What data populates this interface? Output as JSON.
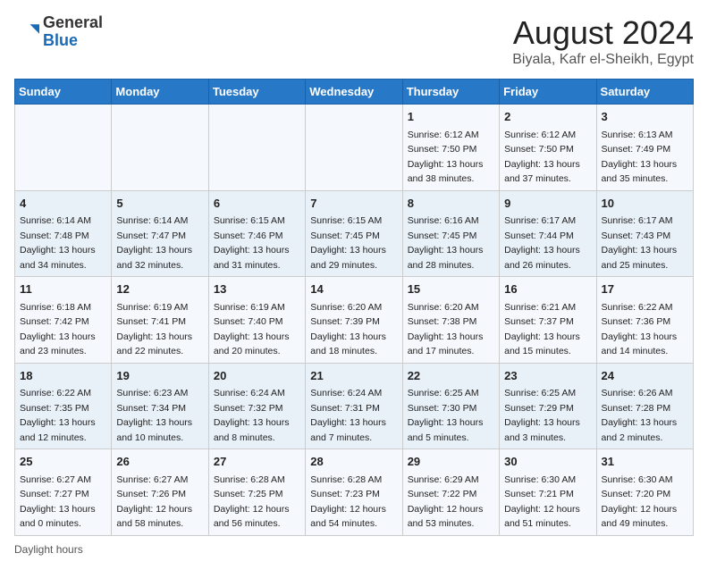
{
  "logo": {
    "general": "General",
    "blue": "Blue"
  },
  "title": "August 2024",
  "subtitle": "Biyala, Kafr el-Sheikh, Egypt",
  "days_of_week": [
    "Sunday",
    "Monday",
    "Tuesday",
    "Wednesday",
    "Thursday",
    "Friday",
    "Saturday"
  ],
  "weeks": [
    [
      {
        "day": "",
        "info": ""
      },
      {
        "day": "",
        "info": ""
      },
      {
        "day": "",
        "info": ""
      },
      {
        "day": "",
        "info": ""
      },
      {
        "day": "1",
        "info": "Sunrise: 6:12 AM\nSunset: 7:50 PM\nDaylight: 13 hours and 38 minutes."
      },
      {
        "day": "2",
        "info": "Sunrise: 6:12 AM\nSunset: 7:50 PM\nDaylight: 13 hours and 37 minutes."
      },
      {
        "day": "3",
        "info": "Sunrise: 6:13 AM\nSunset: 7:49 PM\nDaylight: 13 hours and 35 minutes."
      }
    ],
    [
      {
        "day": "4",
        "info": "Sunrise: 6:14 AM\nSunset: 7:48 PM\nDaylight: 13 hours and 34 minutes."
      },
      {
        "day": "5",
        "info": "Sunrise: 6:14 AM\nSunset: 7:47 PM\nDaylight: 13 hours and 32 minutes."
      },
      {
        "day": "6",
        "info": "Sunrise: 6:15 AM\nSunset: 7:46 PM\nDaylight: 13 hours and 31 minutes."
      },
      {
        "day": "7",
        "info": "Sunrise: 6:15 AM\nSunset: 7:45 PM\nDaylight: 13 hours and 29 minutes."
      },
      {
        "day": "8",
        "info": "Sunrise: 6:16 AM\nSunset: 7:45 PM\nDaylight: 13 hours and 28 minutes."
      },
      {
        "day": "9",
        "info": "Sunrise: 6:17 AM\nSunset: 7:44 PM\nDaylight: 13 hours and 26 minutes."
      },
      {
        "day": "10",
        "info": "Sunrise: 6:17 AM\nSunset: 7:43 PM\nDaylight: 13 hours and 25 minutes."
      }
    ],
    [
      {
        "day": "11",
        "info": "Sunrise: 6:18 AM\nSunset: 7:42 PM\nDaylight: 13 hours and 23 minutes."
      },
      {
        "day": "12",
        "info": "Sunrise: 6:19 AM\nSunset: 7:41 PM\nDaylight: 13 hours and 22 minutes."
      },
      {
        "day": "13",
        "info": "Sunrise: 6:19 AM\nSunset: 7:40 PM\nDaylight: 13 hours and 20 minutes."
      },
      {
        "day": "14",
        "info": "Sunrise: 6:20 AM\nSunset: 7:39 PM\nDaylight: 13 hours and 18 minutes."
      },
      {
        "day": "15",
        "info": "Sunrise: 6:20 AM\nSunset: 7:38 PM\nDaylight: 13 hours and 17 minutes."
      },
      {
        "day": "16",
        "info": "Sunrise: 6:21 AM\nSunset: 7:37 PM\nDaylight: 13 hours and 15 minutes."
      },
      {
        "day": "17",
        "info": "Sunrise: 6:22 AM\nSunset: 7:36 PM\nDaylight: 13 hours and 14 minutes."
      }
    ],
    [
      {
        "day": "18",
        "info": "Sunrise: 6:22 AM\nSunset: 7:35 PM\nDaylight: 13 hours and 12 minutes."
      },
      {
        "day": "19",
        "info": "Sunrise: 6:23 AM\nSunset: 7:34 PM\nDaylight: 13 hours and 10 minutes."
      },
      {
        "day": "20",
        "info": "Sunrise: 6:24 AM\nSunset: 7:32 PM\nDaylight: 13 hours and 8 minutes."
      },
      {
        "day": "21",
        "info": "Sunrise: 6:24 AM\nSunset: 7:31 PM\nDaylight: 13 hours and 7 minutes."
      },
      {
        "day": "22",
        "info": "Sunrise: 6:25 AM\nSunset: 7:30 PM\nDaylight: 13 hours and 5 minutes."
      },
      {
        "day": "23",
        "info": "Sunrise: 6:25 AM\nSunset: 7:29 PM\nDaylight: 13 hours and 3 minutes."
      },
      {
        "day": "24",
        "info": "Sunrise: 6:26 AM\nSunset: 7:28 PM\nDaylight: 13 hours and 2 minutes."
      }
    ],
    [
      {
        "day": "25",
        "info": "Sunrise: 6:27 AM\nSunset: 7:27 PM\nDaylight: 13 hours and 0 minutes."
      },
      {
        "day": "26",
        "info": "Sunrise: 6:27 AM\nSunset: 7:26 PM\nDaylight: 12 hours and 58 minutes."
      },
      {
        "day": "27",
        "info": "Sunrise: 6:28 AM\nSunset: 7:25 PM\nDaylight: 12 hours and 56 minutes."
      },
      {
        "day": "28",
        "info": "Sunrise: 6:28 AM\nSunset: 7:23 PM\nDaylight: 12 hours and 54 minutes."
      },
      {
        "day": "29",
        "info": "Sunrise: 6:29 AM\nSunset: 7:22 PM\nDaylight: 12 hours and 53 minutes."
      },
      {
        "day": "30",
        "info": "Sunrise: 6:30 AM\nSunset: 7:21 PM\nDaylight: 12 hours and 51 minutes."
      },
      {
        "day": "31",
        "info": "Sunrise: 6:30 AM\nSunset: 7:20 PM\nDaylight: 12 hours and 49 minutes."
      }
    ]
  ],
  "footer": {
    "daylight_label": "Daylight hours"
  }
}
